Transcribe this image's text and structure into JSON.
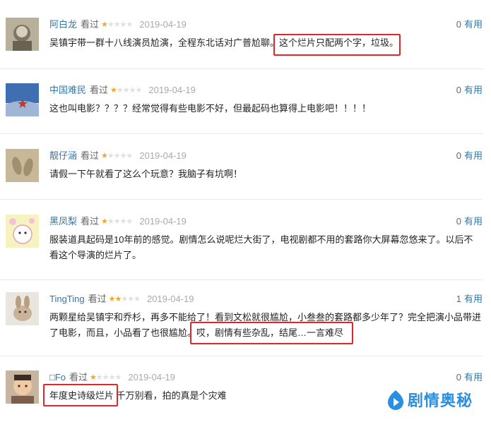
{
  "reviews": [
    {
      "user": "阿白龙",
      "watched": "看过",
      "rating": 1,
      "date": "2019-04-19",
      "count": "0",
      "useful": "有用",
      "lines": [
        "吴镇宇带一群十八线演员尬演，全程东北话对广普尬聊。这个烂片只配两个字，垃圾。"
      ]
    },
    {
      "user": "中国难民",
      "watched": "看过",
      "rating": 1,
      "date": "2019-04-19",
      "count": "0",
      "useful": "有用",
      "lines": [
        "这也叫电影？？？？经常觉得有些电影不好，但最起码也算得上电影吧！！！！"
      ]
    },
    {
      "user": "靓仔涵",
      "watched": "看过",
      "rating": 1,
      "date": "2019-04-19",
      "count": "0",
      "useful": "有用",
      "lines": [
        "请假一下午就看了这么个玩意？我脑子有坑啊！"
      ]
    },
    {
      "user": "黑凤梨",
      "watched": "看过",
      "rating": 1,
      "date": "2019-04-19",
      "count": "0",
      "useful": "有用",
      "lines": [
        "服装道具起码是10年前的感觉。剧情怎么说呢烂大街了，电视剧都不用的套路你大屏幕忽悠来了。以后不",
        "看这个导演的烂片了。"
      ]
    },
    {
      "user": "TingTing",
      "watched": "看过",
      "rating": 2,
      "date": "2019-04-19",
      "count": "1",
      "useful": "有用",
      "lines": [
        "两颗星给吴镇宇和乔杉，再多不能给了！看到文松就很尴尬，小叁叁的套路都多少年了？完全把演小品带进",
        "了电影，而且，小品看了也很尴尬。哎，剧情有些杂乱，结尾…一言难尽"
      ]
    },
    {
      "user": "□Fo",
      "watched": "看过",
      "rating": 1,
      "date": "2019-04-19",
      "count": "0",
      "useful": "有用",
      "lines": [
        "年度史诗级烂片  千万别看，拍的真是个灾难"
      ]
    }
  ],
  "watermark": "剧情奥秘",
  "colors": {
    "link": "#3377aa",
    "star": "#f5a623",
    "highlight": "#e0252b",
    "watermark": "#2a8fe0"
  }
}
